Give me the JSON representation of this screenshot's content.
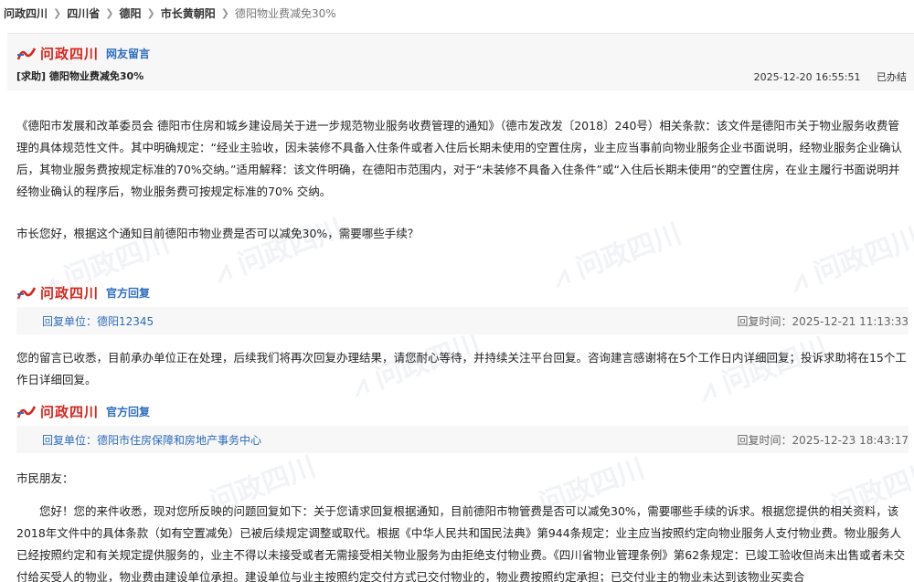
{
  "breadcrumb": {
    "items": [
      "问政四川",
      "四川省",
      "德阳",
      "市长黄朝阳",
      "德阳物业费减免30%"
    ]
  },
  "brand": {
    "name": "问政四川",
    "color": "#d9251d",
    "accent": "#2f6dbd"
  },
  "request": {
    "section_label": "网友留言",
    "title": "[求助] 德阳物业费减免30%",
    "timestamp": "2025-12-20 16:55:51",
    "status": "已办结",
    "body": "《德阳市发展和改革委员会 德阳市住房和城乡建设局关于进一步规范物业服务收费管理的通知》（德市发改发〔2018〕240号）相关条款：该文件是德阳市关于物业服务收费管理的具体规范性文件。其中明确规定：“经业主验收，因未装修不具备入住条件或者入住后长期未使用的空置住房，业主应当事前向物业服务企业书面说明，经物业服务企业确认后，其物业服务费按规定标准的70%交纳。”适用解释：该文件明确，在德阳市范围内，对于“未装修不具备入住条件”或“入住后长期未使用”的空置住房，在业主履行书面说明并经物业确认的程序后，物业服务费可按规定标准的70% 交纳。",
    "question": "市长您好，根据这个通知目前德阳市物业费是否可以减免30%，需要哪些手续？"
  },
  "replies": [
    {
      "section_label": "官方回复",
      "unit": "回复单位：德阳12345",
      "time": "回复时间：2025-12-21 11:13:33",
      "body": "您的留言已收悉，目前承办单位正在处理，后续我们将再次回复办理结果，请您耐心等待，并持续关注平台回复。咨询建言感谢将在5个工作日内详细回复；投诉求助将在15个工作日详细回复。"
    },
    {
      "section_label": "官方回复",
      "unit": "回复单位：德阳市住房保障和房地产事务中心",
      "time": "回复时间：2025-12-23 18:43:17",
      "greeting": "市民朋友：",
      "body": "您好！您的来件收悉，现对您所反映的问题回复如下：关于您请求回复根据通知，目前德阳市物管费是否可以减免30%，需要哪些手续的诉求。根据您提供的相关资料，该2018年文件中的具体条款（如有空置减免）已被后续规定调整或取代。根据《中华人民共和国民法典》第944条规定：业主应当按照约定向物业服务人支付物业费。物业服务人已经按照约定和有关规定提供服务的，业主不得以未接受或者无需接受相关物业服务为由拒绝支付物业费。《四川省物业管理条例》第62条规定：已竣工验收但尚未出售或者未交付给买受人的物业，物业费由建设单位承担。建设单位与业主按照约定交付方式已交付物业的，物业费按照约定承担；已交付业主的物业未达到该物业买卖合"
    }
  ]
}
